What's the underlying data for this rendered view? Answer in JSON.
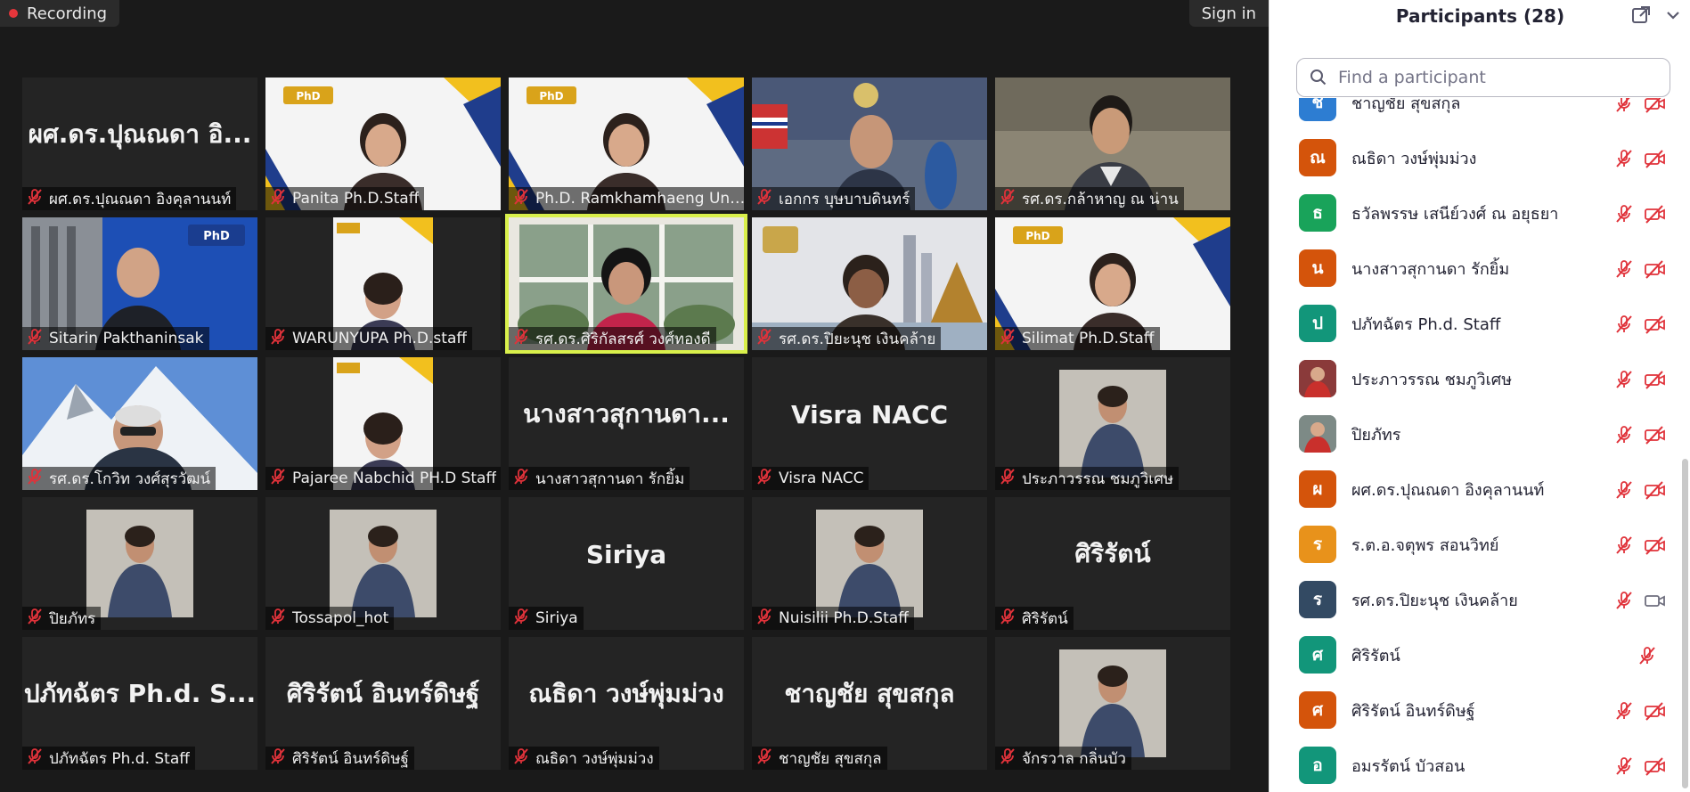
{
  "meeting": {
    "recording_label": "Recording",
    "signin_label": "Sign in"
  },
  "tiles": [
    {
      "name": "ผศ.ดร.ปุณณดา อิงคุลานนท์",
      "display": "ผศ.ดร.ปุณณดา อิ...",
      "video": false
    },
    {
      "name": "Panita Ph.D.Staff",
      "video": true,
      "kind": "slide"
    },
    {
      "name": "Ph.D. Ramkhamhaeng Unive...",
      "video": true,
      "kind": "slide"
    },
    {
      "name": "เอกกร บุษบาบดินทร์",
      "video": true,
      "kind": "office"
    },
    {
      "name": "รศ.ดร.กล้าหาญ ณ น่าน",
      "video": true,
      "kind": "room"
    },
    {
      "name": "Sitarin Pakthaninsak",
      "video": true,
      "kind": "blue"
    },
    {
      "name": "WARUNYUPA Ph.D.staff",
      "video": true,
      "kind": "portrait"
    },
    {
      "name": "รศ.ดร.ศิริกัลสรศ์ วงศ์ทองดี",
      "video": true,
      "kind": "window",
      "active": true
    },
    {
      "name": "รศ.ดร.ปิยะนุช เงินคล้าย",
      "video": true,
      "kind": "temple"
    },
    {
      "name": "Silimat Ph.D.Staff",
      "video": true,
      "kind": "slide"
    },
    {
      "name": "รศ.ดร.โกวิท วงศ์สุรวัฒน์",
      "video": true,
      "kind": "mountain"
    },
    {
      "name": "Pajaree Nabchid PH.D Staff",
      "video": true,
      "kind": "portrait"
    },
    {
      "name": "นางสาวสุกานดา  รักยิ้ม",
      "display": "นางสาวสุกานดา...",
      "video": false
    },
    {
      "name": "Visra NACC",
      "display": "Visra NACC",
      "video": false
    },
    {
      "name": "ประภาวรรณ ชมภูวิเศษ",
      "video": true,
      "kind": "photo"
    },
    {
      "name": "ปิยภัทร",
      "video": true,
      "kind": "photo"
    },
    {
      "name": "Tossapol_hot",
      "video": true,
      "kind": "photo"
    },
    {
      "name": "Siriya",
      "display": "Siriya",
      "video": false
    },
    {
      "name": "Nuisilii Ph.D.Staff",
      "video": true,
      "kind": "photo"
    },
    {
      "name": "ศิริรัตน์",
      "display": "ศิริรัตน์",
      "video": false
    },
    {
      "name": "ปภัทฉัตร Ph.d. Staff",
      "display": "ปภัทฉัตร Ph.d. S...",
      "video": false
    },
    {
      "name": "ศิริรัตน์ อินทร์ดิษฐ์",
      "display": "ศิริรัตน์ อินทร์ดิษฐ์",
      "video": false
    },
    {
      "name": "ณธิดา วงษ์พุ่มม่วง",
      "display": "ณธิดา วงษ์พุ่มม่วง",
      "video": false
    },
    {
      "name": "ชาญชัย สุขสกุล",
      "display": "ชาญชัย สุขสกุล",
      "video": false
    },
    {
      "name": "จักรวาล กลิ่นบัว",
      "video": true,
      "kind": "photo"
    }
  ],
  "panel": {
    "title": "Participants (28)",
    "search_placeholder": "Find a participant",
    "participants": [
      {
        "initial": "ช",
        "name": "ชาญชัย สุขสกุล",
        "color": "#2d7dd2",
        "video": "off"
      },
      {
        "initial": "ณ",
        "name": "ณธิดา วงษ์พุ่มม่วง",
        "color": "#d4540b",
        "video": "off"
      },
      {
        "initial": "ธ",
        "name": "ธวัลพรรษ เสนีย์วงศ์ ณ อยุธยา",
        "color": "#19a35a",
        "video": "off"
      },
      {
        "initial": "น",
        "name": "นางสาวสุกานดา  รักยิ้ม",
        "color": "#d4540b",
        "video": "off"
      },
      {
        "initial": "ป",
        "name": "ปภัทฉัตร Ph.d. Staff",
        "color": "#12967a",
        "video": "off"
      },
      {
        "initial": "",
        "name": "ประภาวรรณ ชมภูวิเศษ",
        "color": "#8a3a3a",
        "video": "off",
        "photo": true
      },
      {
        "initial": "",
        "name": "ปิยภัทร",
        "color": "#7d8a86",
        "video": "off",
        "photo": true
      },
      {
        "initial": "ผ",
        "name": "ผศ.ดร.ปุณณดา อิงคุลานนท์",
        "color": "#d4540b",
        "video": "off"
      },
      {
        "initial": "ร",
        "name": "ร.ต.อ.จตุพร  สอนวิทย์",
        "color": "#e8921b",
        "video": "off"
      },
      {
        "initial": "ร",
        "name": "รศ.ดร.ปิยะนุช เงินคล้าย",
        "color": "#334a63",
        "video": "on"
      },
      {
        "initial": "ศ",
        "name": "ศิริรัตน์",
        "color": "#12967a",
        "video": "none"
      },
      {
        "initial": "ศ",
        "name": "ศิริรัตน์ อินทร์ดิษฐ์",
        "color": "#d4540b",
        "video": "off"
      },
      {
        "initial": "อ",
        "name": "อมรรัตน์  บัวสอน",
        "color": "#12967a",
        "video": "off"
      }
    ]
  },
  "colors": {
    "mute_red": "#e0323a",
    "active_speaker": "#d9f04b",
    "tile_bg": "#242424"
  }
}
